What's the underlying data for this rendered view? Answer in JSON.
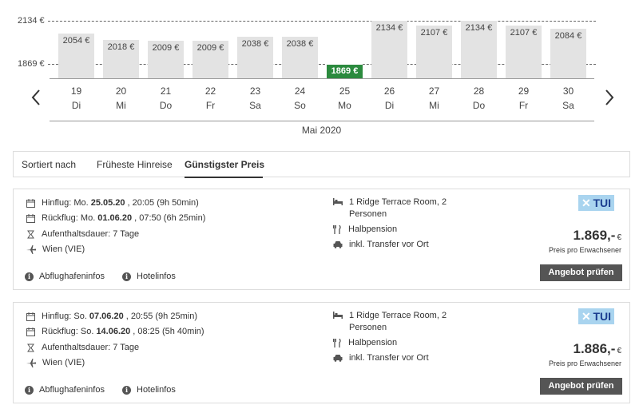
{
  "chart_data": {
    "type": "bar",
    "ref_lines": [
      {
        "label": "2134 €",
        "value": 2134
      },
      {
        "label": "1869 €",
        "value": 1869
      }
    ],
    "bars": [
      {
        "day": "19",
        "weekday": "Di",
        "value": 2054,
        "label": "2054 €"
      },
      {
        "day": "20",
        "weekday": "Mi",
        "value": 2018,
        "label": "2018 €"
      },
      {
        "day": "21",
        "weekday": "Do",
        "value": 2009,
        "label": "2009 €"
      },
      {
        "day": "22",
        "weekday": "Fr",
        "value": 2009,
        "label": "2009 €"
      },
      {
        "day": "23",
        "weekday": "Sa",
        "value": 2038,
        "label": "2038 €"
      },
      {
        "day": "24",
        "weekday": "So",
        "value": 2038,
        "label": "2038 €"
      },
      {
        "day": "25",
        "weekday": "Mo",
        "value": 1869,
        "label": "1869 €",
        "highlight": true
      },
      {
        "day": "26",
        "weekday": "Di",
        "value": 2134,
        "label": "2134 €"
      },
      {
        "day": "27",
        "weekday": "Mi",
        "value": 2107,
        "label": "2107 €"
      },
      {
        "day": "28",
        "weekday": "Do",
        "value": 2134,
        "label": "2134 €"
      },
      {
        "day": "29",
        "weekday": "Fr",
        "value": 2107,
        "label": "2107 €"
      },
      {
        "day": "30",
        "weekday": "Sa",
        "value": 2084,
        "label": "2084 €"
      }
    ],
    "month": "Mai 2020",
    "highlight_color": "#2b8a3e"
  },
  "sort": {
    "label": "Sortiert nach",
    "options": [
      "Früheste Hinreise",
      "Günstigster Preis"
    ],
    "active": "Günstigster Preis"
  },
  "offers": [
    {
      "outbound": {
        "label": "Hinflug:",
        "day": "Mo.",
        "date": "25.05.20",
        "rest": ", 20:05 (9h 50min)"
      },
      "inbound": {
        "label": "Rückflug:",
        "day": "Mo.",
        "date": "01.06.20",
        "rest": ", 07:50 (6h 25min)"
      },
      "stay": "Aufenthaltsdauer: 7 Tage",
      "airport": "Wien (VIE)",
      "room_line1": "1 Ridge Terrace Room, 2",
      "room_line2": "Personen",
      "board": "Halbpension",
      "transfer": "inkl. Transfer vor Ort",
      "operator": "TUI",
      "price": "1.869,-",
      "currency": "€",
      "price_note": "Preis pro Erwachsener",
      "cta": "Angebot prüfen",
      "link_airport": "Abflughafeninfos",
      "link_hotel": "Hotelinfos"
    },
    {
      "outbound": {
        "label": "Hinflug:",
        "day": "So.",
        "date": "07.06.20",
        "rest": ", 20:55 (9h 25min)"
      },
      "inbound": {
        "label": "Rückflug:",
        "day": "So.",
        "date": "14.06.20",
        "rest": ", 08:25 (5h 40min)"
      },
      "stay": "Aufenthaltsdauer: 7 Tage",
      "airport": "Wien (VIE)",
      "room_line1": "1 Ridge Terrace Room, 2",
      "room_line2": "Personen",
      "board": "Halbpension",
      "transfer": "inkl. Transfer vor Ort",
      "operator": "TUI",
      "price": "1.886,-",
      "currency": "€",
      "price_note": "Preis pro Erwachsener",
      "cta": "Angebot prüfen",
      "link_airport": "Abflughafeninfos",
      "link_hotel": "Hotelinfos"
    }
  ]
}
